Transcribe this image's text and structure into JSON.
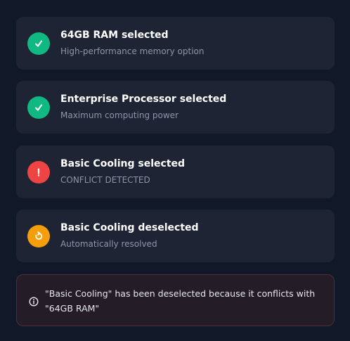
{
  "events": [
    {
      "title": "64GB RAM selected",
      "subtitle": "High-performance memory option",
      "status": "success",
      "icon": "check-icon",
      "color": "#10b981"
    },
    {
      "title": "Enterprise Processor selected",
      "subtitle": "Maximum computing power",
      "status": "success",
      "icon": "check-icon",
      "color": "#10b981"
    },
    {
      "title": "Basic Cooling selected",
      "subtitle": "CONFLICT DETECTED",
      "status": "error",
      "icon": "exclamation-icon",
      "color": "#ef4444"
    },
    {
      "title": "Basic Cooling deselected",
      "subtitle": "Automatically resolved",
      "status": "resolved",
      "icon": "refresh-icon",
      "color": "#f59e0b"
    }
  ],
  "notice": {
    "icon": "info-icon",
    "text": "\"Basic Cooling\" has been deselected because it conflicts with \"64GB RAM\""
  },
  "colors": {
    "background": "#111827",
    "card": "#1e2433",
    "notice_background": "#241d27",
    "notice_border": "#4a2f38"
  }
}
